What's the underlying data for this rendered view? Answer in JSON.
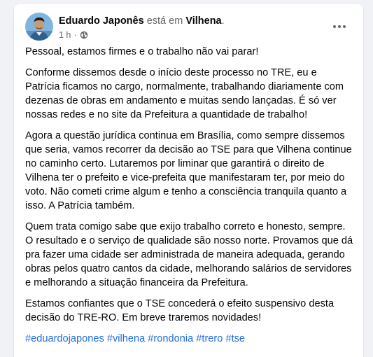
{
  "post": {
    "author_name": "Eduardo Japonês",
    "connector_text": " está em ",
    "location": "Vilhena",
    "trailing_dot": ".",
    "timestamp": "1 h",
    "dot": "·",
    "audience_icon": "globe-icon",
    "more_icon": "more-horizontal-icon",
    "paragraphs": [
      "Pessoal, estamos firmes e o trabalho não vai parar!",
      "Conforme dissemos desde o início deste processo no TRE, eu e Patrícia ficamos no cargo, normalmente, trabalhando diariamente com dezenas de obras em andamento e muitas sendo lançadas. É só ver nossas redes e no site da Prefeitura a quantidade de trabalho!",
      "Agora a questão jurídica continua em Brasília, como sempre dissemos que seria, vamos recorrer da decisão ao TSE para que Vilhena continue no caminho certo. Lutaremos por liminar que garantirá o direito de Vilhena ter o prefeito e vice-prefeita que manifestaram ter, por meio do voto. Não cometi crime algum e tenho a consciência tranquila quanto a isso. A Patrícia também.",
      "Quem trata comigo sabe que exijo trabalho correto e honesto, sempre. O resultado e o serviço de qualidade são nosso norte. Provamos que dá pra fazer uma cidade ser administrada de maneira adequada, gerando obras pelos quatro cantos da cidade, melhorando salários de servidores e melhorando a situação financeira da Prefeitura.",
      "Estamos confiantes que o TSE concederá o efeito suspensivo desta decisão do TRE-RO. Em breve traremos novidades!"
    ],
    "hashtags": [
      "#eduardojapones",
      "#vilhena",
      "#rondonia",
      "#trero",
      "#tse"
    ]
  },
  "colors": {
    "link": "#216fdb",
    "text": "#050505",
    "secondary": "#65676b",
    "background": "#f0f2f5"
  }
}
